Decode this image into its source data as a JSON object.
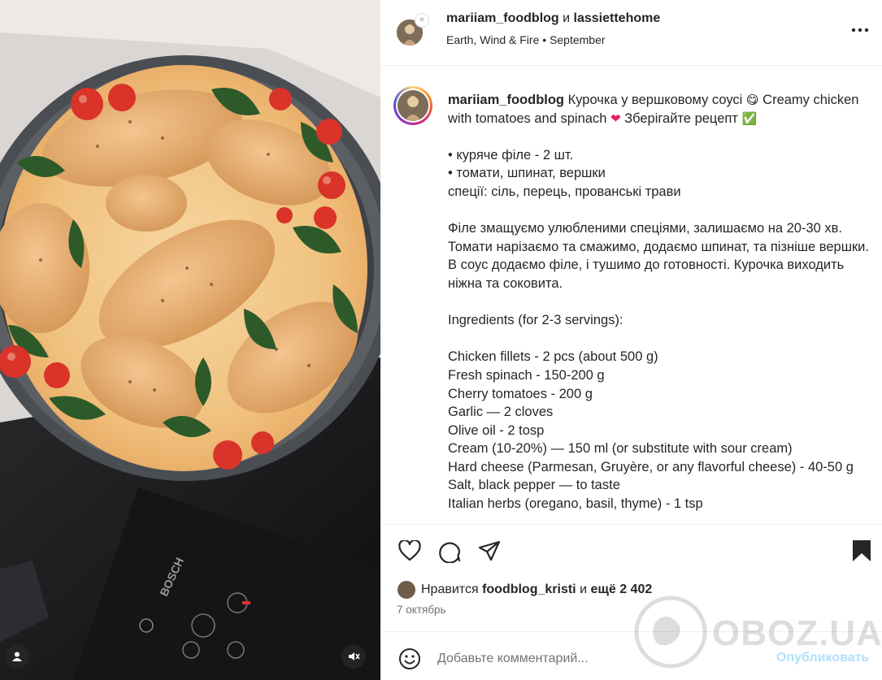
{
  "post": {
    "author": "mariiam_foodblog",
    "conjunction": "и",
    "collaborator": "lassiettehome",
    "collab_avatar_text": "ltt",
    "music": "Earth, Wind & Fire",
    "music_separator": "•",
    "music_subtitle": "September"
  },
  "caption": {
    "username": "mariiam_foodblog",
    "title_parts": [
      "Курочка у вершковому соусі",
      "Creamy chicken with tomatoes and spinach",
      "Зберігайте рецепт"
    ],
    "emojis": {
      "yum": "😋",
      "heart": "❤",
      "check": "✅"
    },
    "lines_block1": [
      "• куряче філе - 2 шт.",
      "• томати, шпинат, вершки",
      "спеції: сіль, перець, прованські трави"
    ],
    "paragraph_ua": "Філе змащуємо улюбленими спеціями, залишаємо на 20-30 хв. Томати нарізаємо та смажимо, додаємо шпинат, та пізніше вершки. В соус додаємо філе, і тушимо до готовності. Курочка виходить ніжна та соковита.",
    "ingredients_heading": "Ingredients (for 2-3 servings):",
    "ingredients": [
      "Chicken fillets - 2 pcs (about 500 g)",
      "Fresh spinach - 150-200 g",
      "Cherry tomatoes - 200 g",
      "Garlic — 2 cloves",
      "Olive oil - 2 tosp",
      "Cream (10-20%) — 150 ml (or substitute with sour cream)",
      "Hard cheese (Parmesan, Gruyère, or any flavorful cheese) - 40-50 g",
      "Salt, black pepper — to taste",
      "Italian herbs (oregano, basil, thyme) - 1 tsp"
    ]
  },
  "media": {
    "stove_brand": "BOSCH"
  },
  "actions": {
    "icons": [
      "heart-icon",
      "comment-icon",
      "share-icon",
      "bookmark-icon"
    ]
  },
  "likes": {
    "prefix": "Нравится",
    "user": "foodblog_kristi",
    "middle": "и",
    "count": "ещё 2 402"
  },
  "date": "7 октябрь",
  "comment": {
    "placeholder": "Добавьте комментарий...",
    "post_label": "Опубликовать"
  },
  "watermark": {
    "text": "OBOZ.UA"
  },
  "colors": {
    "accent_link": "#b2dffc",
    "text": "#262626",
    "secondary": "#737373",
    "check": "#3ec33e",
    "heart": "#e0245e"
  }
}
